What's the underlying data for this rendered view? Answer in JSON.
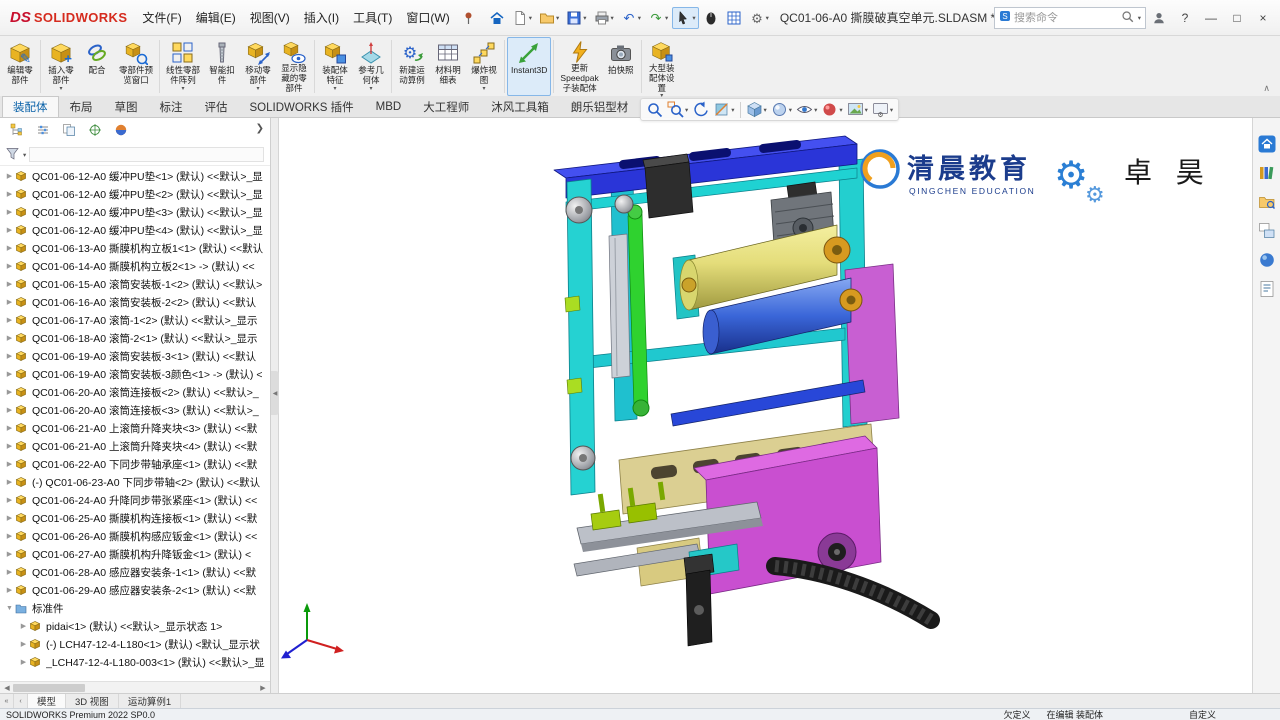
{
  "window": {
    "brand_ds": "DS",
    "brand": "SOLIDWORKS",
    "title": "QC01-06-A0 撕膜破真空单元.SLDASM *",
    "search_placeholder": "搜索命令",
    "controls": {
      "help": "?",
      "min": "—",
      "max": "□",
      "close": "×"
    }
  },
  "menus": [
    "文件(F)",
    "编辑(E)",
    "视图(V)",
    "插入(I)",
    "工具(T)",
    "窗口(W)"
  ],
  "qat": [
    {
      "name": "home-button",
      "kind": "home"
    },
    {
      "name": "new-document-button",
      "kind": "doc",
      "arrow": true
    },
    {
      "name": "open-button",
      "kind": "folder",
      "arrow": true
    },
    {
      "name": "save-button",
      "kind": "save",
      "arrow": true
    },
    {
      "name": "print-button",
      "kind": "printer",
      "arrow": true
    },
    {
      "name": "undo-button",
      "kind": "undo",
      "arrow": true
    },
    {
      "name": "redo-button",
      "kind": "redo",
      "arrow": true
    },
    {
      "name": "select-tool-button",
      "kind": "cursor",
      "arrow": true,
      "pressed": true
    },
    {
      "name": "3d-mouse-button",
      "kind": "mouse"
    },
    {
      "name": "task-grid-button",
      "kind": "grid"
    },
    {
      "name": "options-button",
      "kind": "gear",
      "arrow": true
    }
  ],
  "ribbon": {
    "collapse_glyph": "∧",
    "buttons": [
      {
        "name": "edit-component-button",
        "label": "编辑零\n部件",
        "kind": "cube",
        "ov": "✎",
        "sepAfter": true
      },
      {
        "name": "insert-components-button",
        "label": "插入零\n部件",
        "kind": "cube",
        "ov": "+",
        "arrow": true
      },
      {
        "name": "mate-button",
        "label": "配合",
        "kind": "clip"
      },
      {
        "name": "component-preview-button",
        "label": "零部件预\n览窗口",
        "kind": "preview",
        "sepAfter": true
      },
      {
        "name": "linear-pattern-button",
        "label": "线性零部\n件阵列",
        "kind": "pattern",
        "arrow": true
      },
      {
        "name": "smart-fasteners-button",
        "label": "智能扣\n件",
        "kind": "screw"
      },
      {
        "name": "move-component-button",
        "label": "移动零\n部件",
        "kind": "move",
        "arrow": true
      },
      {
        "name": "show-hidden-button",
        "label": "显示隐\n藏的零\n部件",
        "kind": "eyecube",
        "sepAfter": true
      },
      {
        "name": "assembly-features-button",
        "label": "装配体\n特征",
        "kind": "asmfeat",
        "arrow": true
      },
      {
        "name": "reference-geometry-button",
        "label": "参考几\n何体",
        "kind": "plane",
        "arrow": true,
        "sepAfter": true
      },
      {
        "name": "new-motion-study-button",
        "label": "新建运\n动算例",
        "kind": "motion"
      },
      {
        "name": "bom-button",
        "label": "材料明\n细表",
        "kind": "table"
      },
      {
        "name": "exploded-view-button",
        "label": "爆炸视\n图",
        "kind": "explode",
        "arrow": true,
        "sepAfter": true
      },
      {
        "name": "instant3d-button",
        "label": "Instant3D",
        "kind": "instant3d",
        "pressed": true,
        "sepAfter": true
      },
      {
        "name": "update-speedpak-button",
        "label": "更新\nSpeedpak\n子装配体",
        "kind": "speedpak"
      },
      {
        "name": "take-snapshot-button",
        "label": "拍快照",
        "kind": "camera",
        "sepAfter": true
      },
      {
        "name": "large-assembly-button",
        "label": "大型装\n配体设\n置",
        "kind": "bigasm",
        "arrow": true
      }
    ],
    "tabs": [
      {
        "label": "装配体",
        "active": true
      },
      {
        "label": "布局"
      },
      {
        "label": "草图"
      },
      {
        "label": "标注"
      },
      {
        "label": "评估"
      },
      {
        "label": "SOLIDWORKS 插件"
      },
      {
        "label": "MBD"
      },
      {
        "label": "大工程师"
      },
      {
        "label": "沐风工具箱"
      },
      {
        "label": "朗乐铝型材"
      }
    ]
  },
  "panel": {
    "flyout_glyph": "❯",
    "collapse_glyph": "◀",
    "manager_tabs": [
      {
        "name": "featuremanager-tab",
        "kind": "fm"
      },
      {
        "name": "propertymanager-tab",
        "kind": "pm"
      },
      {
        "name": "configurationmanager-tab",
        "kind": "cm"
      },
      {
        "name": "dimxpert-tab",
        "kind": "dx"
      },
      {
        "name": "displaymanager-tab",
        "kind": "dm"
      }
    ],
    "tree": [
      {
        "t": "QC01-06-12-A0 缓冲PU垫<1> (默认) <<默认>_显",
        "i": "part",
        "l": 0,
        "e": "c"
      },
      {
        "t": "QC01-06-12-A0 缓冲PU垫<2> (默认) <<默认>_显",
        "i": "part",
        "l": 0,
        "e": "c"
      },
      {
        "t": "QC01-06-12-A0 缓冲PU垫<3> (默认) <<默认>_显",
        "i": "part",
        "l": 0,
        "e": "c"
      },
      {
        "t": "QC01-06-12-A0 缓冲PU垫<4> (默认) <<默认>_显",
        "i": "part",
        "l": 0,
        "e": "c"
      },
      {
        "t": "QC01-06-13-A0 撕膜机构立板1<1> (默认) <<默认",
        "i": "part",
        "l": 0,
        "e": "c"
      },
      {
        "t": "QC01-06-14-A0 撕膜机构立板2<1> -> (默认) <<",
        "i": "part",
        "l": 0,
        "e": "c"
      },
      {
        "t": "QC01-06-15-A0 滚筒安装板-1<2> (默认) <<默认>",
        "i": "part",
        "l": 0,
        "e": "c"
      },
      {
        "t": "QC01-06-16-A0 滚筒安装板-2<2> (默认) <<默认",
        "i": "part",
        "l": 0,
        "e": "c"
      },
      {
        "t": "QC01-06-17-A0 滚筒-1<2> (默认) <<默认>_显示",
        "i": "part",
        "l": 0,
        "e": "c"
      },
      {
        "t": "QC01-06-18-A0 滚筒-2<1> (默认) <<默认>_显示",
        "i": "part",
        "l": 0,
        "e": "c"
      },
      {
        "t": "QC01-06-19-A0 滚筒安装板-3<1> (默认) <<默认",
        "i": "part",
        "l": 0,
        "e": "c"
      },
      {
        "t": "QC01-06-19-A0 滚筒安装板-3颜色<1> -> (默认) <",
        "i": "part",
        "l": 0,
        "e": "c"
      },
      {
        "t": "QC01-06-20-A0 滚筒连接板<2> (默认) <<默认>_",
        "i": "part",
        "l": 0,
        "e": "c"
      },
      {
        "t": "QC01-06-20-A0 滚筒连接板<3> (默认) <<默认>_",
        "i": "part",
        "l": 0,
        "e": "c"
      },
      {
        "t": "QC01-06-21-A0 上滚筒升降夹块<3> (默认) <<默",
        "i": "part",
        "l": 0,
        "e": "c"
      },
      {
        "t": "QC01-06-21-A0 上滚筒升降夹块<4> (默认) <<默",
        "i": "part",
        "l": 0,
        "e": "c"
      },
      {
        "t": "QC01-06-22-A0 下同步带轴承座<1> (默认) <<默",
        "i": "part",
        "l": 0,
        "e": "c"
      },
      {
        "t": "(-) QC01-06-23-A0 下同步带轴<2> (默认) <<默认",
        "i": "part",
        "l": 0,
        "e": "c"
      },
      {
        "t": "QC01-06-24-A0 升降同步带张紧座<1> (默认) <<",
        "i": "part",
        "l": 0,
        "e": "c"
      },
      {
        "t": "QC01-06-25-A0 撕膜机构连接板<1> (默认) <<默",
        "i": "part",
        "l": 0,
        "e": "c"
      },
      {
        "t": "QC01-06-26-A0 撕膜机构感应钣金<1> (默认) <<",
        "i": "part",
        "l": 0,
        "e": "c"
      },
      {
        "t": "QC01-06-27-A0 撕膜机构升降钣金<1> (默认) <",
        "i": "part",
        "l": 0,
        "e": "c"
      },
      {
        "t": "QC01-06-28-A0 感应器安装条-1<1> (默认) <<默",
        "i": "part",
        "l": 0,
        "e": "c"
      },
      {
        "t": "QC01-06-29-A0 感应器安装条-2<1> (默认) <<默",
        "i": "part",
        "l": 0,
        "e": "c"
      },
      {
        "t": "标准件",
        "i": "folder",
        "l": 0,
        "e": "e"
      },
      {
        "t": "pidai<1> (默认) <<默认>_显示状态 1>",
        "i": "part",
        "l": 1,
        "e": "c"
      },
      {
        "t": "(-) LCH47-12-4-L180<1> (默认) <默认_显示状",
        "i": "part",
        "l": 1,
        "e": "c"
      },
      {
        "t": "_LCH47-12-4-L180-003<1> (默认) <<默认>_显",
        "i": "part",
        "l": 1,
        "e": "c"
      }
    ]
  },
  "headsup": [
    {
      "name": "zoom-fit-button",
      "kind": "mag"
    },
    {
      "name": "zoom-area-button",
      "kind": "magplus",
      "arrow": true
    },
    {
      "name": "previous-view-button",
      "kind": "prev"
    },
    {
      "name": "section-view-button",
      "kind": "section",
      "arrow": true
    },
    {
      "sep": true
    },
    {
      "name": "view-orientation-button",
      "kind": "vcube",
      "arrow": true
    },
    {
      "name": "display-style-button",
      "kind": "style",
      "arrow": true
    },
    {
      "name": "hide-show-items-button",
      "kind": "eye",
      "arrow": true
    },
    {
      "name": "edit-appearance-button",
      "kind": "ball",
      "arrow": true
    },
    {
      "name": "apply-scene-button",
      "kind": "scene",
      "arrow": true
    },
    {
      "name": "view-settings-button",
      "kind": "viewset",
      "arrow": true
    }
  ],
  "taskpane": [
    {
      "name": "resources-tab",
      "kind": "tphome"
    },
    {
      "name": "design-library-tab",
      "kind": "tplib"
    },
    {
      "name": "file-explorer-tab",
      "kind": "tpfolder"
    },
    {
      "name": "view-palette-tab",
      "kind": "tppalette"
    },
    {
      "name": "appearances-tab",
      "kind": "tpball"
    },
    {
      "name": "custom-properties-tab",
      "kind": "tpprops"
    }
  ],
  "viewport": {
    "watermark_cn": "清晨教育",
    "watermark_en": "QINGCHEN EDUCATION",
    "watermark_right": "卓 昊"
  },
  "bottom_nav": [
    "«",
    "‹"
  ],
  "bottom_tabs": [
    {
      "label": "模型",
      "active": true
    },
    {
      "label": "3D 视图"
    },
    {
      "label": "运动算例1"
    }
  ],
  "status": {
    "left": "SOLIDWORKS Premium 2022 SP0.0",
    "s1": "欠定义",
    "s2": "在编辑 装配体",
    "s3": "自定义"
  },
  "colors": {
    "brand_red": "#d52b1e",
    "accent_blue": "#0a62a9",
    "pressed_fill": "#dcebf9",
    "pressed_border": "#86b7e8"
  }
}
